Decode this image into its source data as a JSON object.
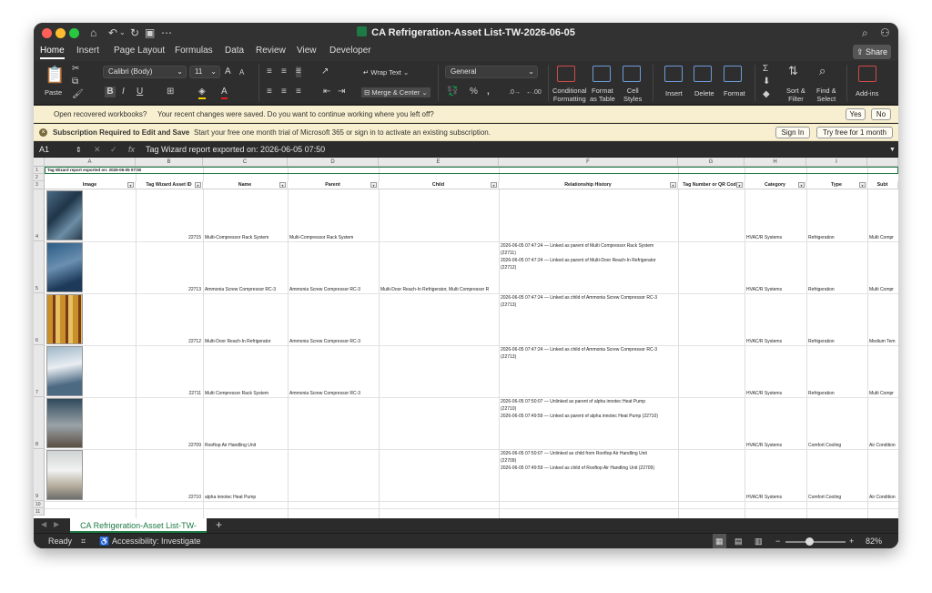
{
  "window": {
    "title": "CA Refrigeration-Asset List-TW-2026-06-05"
  },
  "ribbon_tabs": [
    "Home",
    "Insert",
    "Page Layout",
    "Formulas",
    "Data",
    "Review",
    "View",
    "Developer"
  ],
  "share_label": "Share",
  "ribbon": {
    "paste": "Paste",
    "font": "Calibri (Body)",
    "size": "11",
    "wrap_text": "Wrap Text",
    "merge": "Merge & Center",
    "number_format": "General",
    "conditional": "Conditional\nFormatting",
    "format_table": "Format\nas Table",
    "cell_styles": "Cell\nStyles",
    "insert": "Insert",
    "delete": "Delete",
    "format": "Format",
    "sort_filter": "Sort &\nFilter",
    "find_select": "Find &\nSelect",
    "addins": "Add-ins"
  },
  "recovered_bar": {
    "bold": "Open recovered workbooks?",
    "text": "Your recent changes were saved. Do you want to continue working where you left off?",
    "yes": "Yes",
    "no": "No"
  },
  "subscription_bar": {
    "bold": "Subscription Required to Edit and Save",
    "text": "Start your free one month trial of Microsoft 365 or sign in to activate an existing subscription.",
    "sign_in": "Sign In",
    "try_free": "Try free for 1 month"
  },
  "formula_bar": {
    "cell_ref": "A1",
    "fx": "fx",
    "content": "Tag Wizard report exported on: 2026-06-05 07:50"
  },
  "columns": [
    "A",
    "B",
    "C",
    "D",
    "E",
    "F",
    "G",
    "H",
    "I"
  ],
  "header_row": [
    "Image",
    "Tag Wizard Asset ID",
    "Name",
    "Parent",
    "Child",
    "Relationship History",
    "Tag Number or QR Code",
    "Category",
    "Type",
    "Subt"
  ],
  "title_cell": "Tag Wizard report exported on: 2026-06-05 07:50",
  "row_numbers": [
    "1",
    "2",
    "3",
    "4",
    "5",
    "6",
    "7",
    "8",
    "9",
    "10",
    "11"
  ],
  "rows": [
    {
      "id": "22715",
      "name": "Multi-Compressor Rack System",
      "parent": "Multi-Compressor Rack System",
      "child": "",
      "history": "",
      "category": "HVAC/R Systems",
      "type": "Refrigeration",
      "subtype": "Multi Compr"
    },
    {
      "id": "22713",
      "name": "Ammonia Screw Compressor RC-3",
      "parent": "Ammonia Screw Compressor RC-3",
      "child": "Multi-Door Reach-In Refrigerator, Multi Compressor R",
      "history": "2026-06-05 07:47:24 — Linked as parent of Multi Compressor Rack System\n(22711)\n2026-06-05 07:47:24 — Linked as parent of Multi-Door Reach-In Refrigerator\n(22712)",
      "category": "HVAC/R Systems",
      "type": "Refrigeration",
      "subtype": "Multi Compr"
    },
    {
      "id": "22712",
      "name": "Multi-Door Reach-In Refrigerator",
      "parent": "Ammonia Screw Compressor RC-3",
      "child": "",
      "history": "2026-06-05 07:47:24 — Linked as child of Ammonia Screw Compressor RC-3\n(22713)",
      "category": "HVAC/R Systems",
      "type": "Refrigeration",
      "subtype": "Medium Tem"
    },
    {
      "id": "22711",
      "name": "Multi Compressor Rack System",
      "parent": "Ammonia Screw Compressor RC-3",
      "child": "",
      "history": "2026-06-05 07:47:24 — Linked as child of Ammonia Screw Compressor RC-3\n(22713)",
      "category": "HVAC/R Systems",
      "type": "Refrigeration",
      "subtype": "Multi Compr"
    },
    {
      "id": "22709",
      "name": "Rooftop Air Handling Unit",
      "parent": "",
      "child": "",
      "history": "2026-06-05 07:50:07 — Unlinked as parent of alpha innotec Heat Pump\n(22710)\n2026-06-05 07:49:59 — Linked as parent of alpha innotec Heat Pump (22710)",
      "category": "HVAC/R Systems",
      "type": "Comfort Cooling",
      "subtype": "Air Condition"
    },
    {
      "id": "22710",
      "name": "alpha innotec Heat Pump",
      "parent": "",
      "child": "",
      "history": "2026-06-05 07:50:07 — Unlinked as child from Rooftop Air Handling Unit\n(22709)\n2026-06-05 07:49:59 — Linked as child of Rooftop Air Handling Unit (22709)",
      "category": "HVAC/R Systems",
      "type": "Comfort Cooling",
      "subtype": "Air Condition"
    }
  ],
  "sheet_tab": "CA Refrigeration-Asset List-TW-",
  "status": {
    "ready": "Ready",
    "accessibility": "Accessibility: Investigate",
    "zoom": "82%"
  },
  "colors": {
    "accent": "#1d7a45",
    "close": "#ff5f57",
    "minimize": "#febc2e",
    "maximize": "#28c840"
  }
}
